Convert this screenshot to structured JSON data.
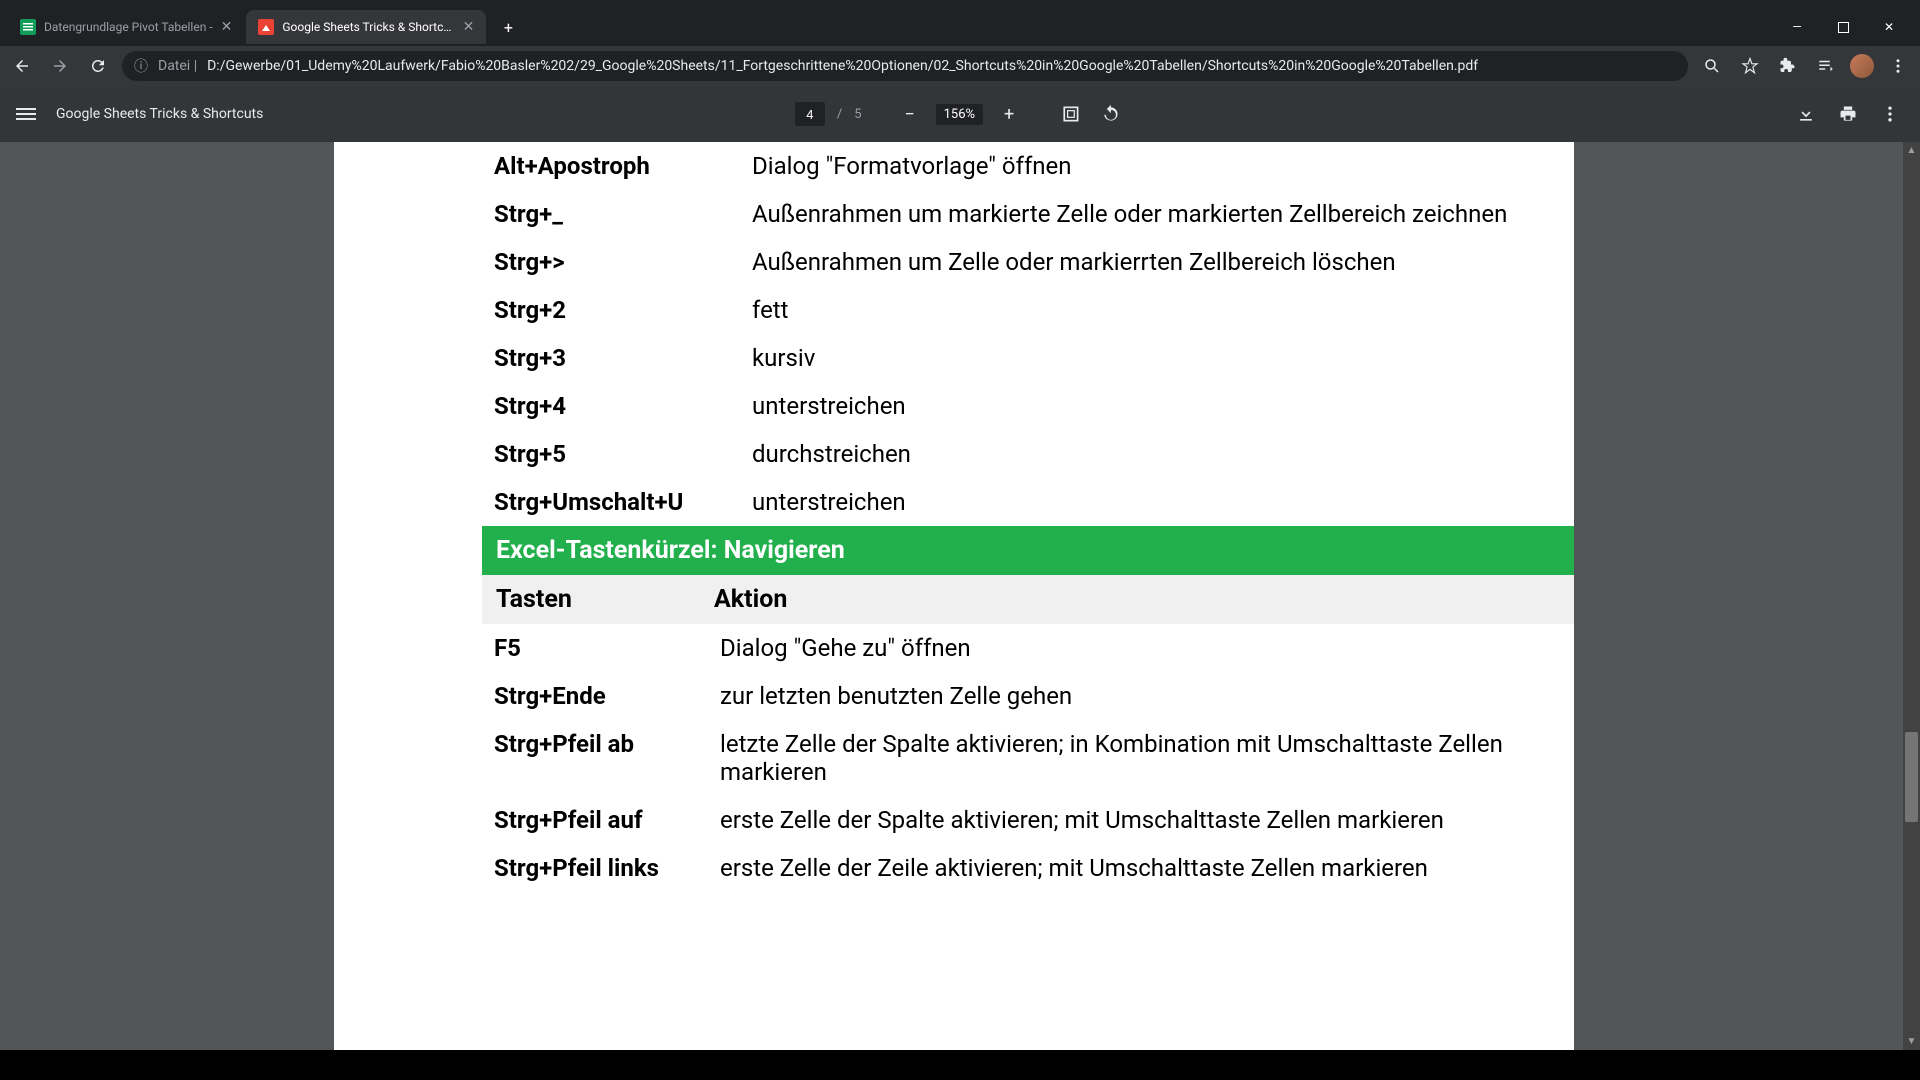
{
  "window": {
    "minimize": "—",
    "maximize": "▢",
    "close": "✕"
  },
  "tabs": [
    {
      "title": "Datengrundlage Pivot Tabellen -",
      "active": false
    },
    {
      "title": "Google Sheets Tricks & Shortcuts",
      "active": true
    }
  ],
  "address": {
    "protocol": "Datei",
    "path": "D:/Gewerbe/01_Udemy%20Laufwerk/Fabio%20Basler%202/29_Google%20Sheets/11_Fortgeschrittene%20Optionen/02_Shortcuts%20in%20Google%20Tabellen/Shortcuts%20in%20Google%20Tabellen.pdf"
  },
  "pdf": {
    "doc_title": "Google Sheets Tricks & Shortcuts",
    "page_current": "4",
    "page_sep": "/",
    "page_total": "5",
    "zoom": "156%"
  },
  "content": {
    "rows1": [
      {
        "key": "Alt+Apostroph",
        "desc": "Dialog \"Formatvorlage\" öffnen"
      },
      {
        "key": "Strg+_",
        "desc": "Außenrahmen um markierte Zelle oder markierten Zellbereich zeichnen"
      },
      {
        "key": "Strg+>",
        "desc": "Außenrahmen um Zelle oder markierrten Zellbereich löschen"
      },
      {
        "key": "Strg+2",
        "desc": "fett"
      },
      {
        "key": "Strg+3",
        "desc": "kursiv"
      },
      {
        "key": "Strg+4",
        "desc": "unterstreichen"
      },
      {
        "key": "Strg+5",
        "desc": "durchstreichen"
      },
      {
        "key": "Strg+Umschalt+U",
        "desc": "unterstreichen"
      }
    ],
    "section_header": "Excel-Tastenkürzel: Navigieren",
    "col1": "Tasten",
    "col2": "Aktion",
    "rows2": [
      {
        "key": "F5",
        "desc": "Dialog \"Gehe zu\" öffnen"
      },
      {
        "key": "Strg+Ende",
        "desc": "zur letzten benutzten Zelle gehen"
      },
      {
        "key": "Strg+Pfeil ab",
        "desc": "letzte Zelle der Spalte aktivieren; in Kombination mit Umschalttaste Zellen markieren"
      },
      {
        "key": "Strg+Pfeil auf",
        "desc": "erste Zelle der Spalte aktivieren; mit Umschalttaste Zellen markieren"
      },
      {
        "key": "Strg+Pfeil links",
        "desc": "erste Zelle der Zeile aktivieren; mit Umschalttaste Zellen markieren"
      }
    ]
  }
}
